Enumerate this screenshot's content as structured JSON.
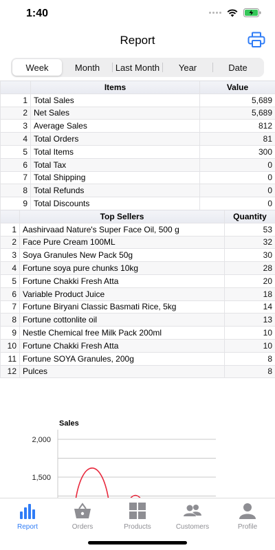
{
  "status": {
    "time": "1:40"
  },
  "nav": {
    "title": "Report"
  },
  "segments": [
    {
      "label": "Week",
      "active": true
    },
    {
      "label": "Month",
      "active": false
    },
    {
      "label": "Last Month",
      "active": false
    },
    {
      "label": "Year",
      "active": false
    },
    {
      "label": "Date",
      "active": false
    }
  ],
  "items_table": {
    "headers": [
      "Items",
      "Value"
    ],
    "rows": [
      {
        "idx": "1",
        "name": "Total Sales",
        "value": "5,689"
      },
      {
        "idx": "2",
        "name": "Net Sales",
        "value": "5,689"
      },
      {
        "idx": "3",
        "name": "Average Sales",
        "value": "812"
      },
      {
        "idx": "4",
        "name": "Total Orders",
        "value": "81"
      },
      {
        "idx": "5",
        "name": "Total Items",
        "value": "300"
      },
      {
        "idx": "6",
        "name": "Total Tax",
        "value": "0"
      },
      {
        "idx": "7",
        "name": "Total Shipping",
        "value": "0"
      },
      {
        "idx": "8",
        "name": "Total Refunds",
        "value": "0"
      },
      {
        "idx": "9",
        "name": "Total Discounts",
        "value": "0"
      }
    ]
  },
  "top_sellers": {
    "headers": [
      "Top Sellers",
      "Quantity"
    ],
    "rows": [
      {
        "idx": "1",
        "name": "Aashirvaad Nature's Super Face Oil, 500 g",
        "qty": "53"
      },
      {
        "idx": "2",
        "name": "Face Pure Cream 100ML",
        "qty": "32"
      },
      {
        "idx": "3",
        "name": "Soya Granules New Pack 50g",
        "qty": "30"
      },
      {
        "idx": "4",
        "name": "Fortune soya pure chunks 10kg",
        "qty": "28"
      },
      {
        "idx": "5",
        "name": "Fortune Chakki Fresh Atta",
        "qty": "20"
      },
      {
        "idx": "6",
        "name": "Variable Product Juice",
        "qty": "18"
      },
      {
        "idx": "7",
        "name": "Fortune Biryani Classic Basmati Rice, 5kg",
        "qty": "14"
      },
      {
        "idx": "8",
        "name": "Fortune cottonlite oil",
        "qty": "13"
      },
      {
        "idx": "9",
        "name": "Nestle Chemical free Milk Pack 200ml",
        "qty": "10"
      },
      {
        "idx": "10",
        "name": "Fortune Chakki Fresh Atta",
        "qty": "10"
      },
      {
        "idx": "11",
        "name": "Fortune SOYA Granules, 200g",
        "qty": "8"
      },
      {
        "idx": "12",
        "name": "Pulces",
        "qty": "8"
      }
    ]
  },
  "chart_data": {
    "type": "line",
    "title": "Sales",
    "y_ticks": [
      "2,000",
      "1,500"
    ],
    "ylim": [
      1300,
      2200
    ],
    "series": [
      {
        "color": "#e8283c",
        "values": [
          1200,
          1700,
          1200
        ]
      }
    ]
  },
  "tabs": [
    {
      "label": "Report",
      "icon": "bar-chart-icon",
      "active": true
    },
    {
      "label": "Orders",
      "icon": "basket-icon",
      "active": false
    },
    {
      "label": "Products",
      "icon": "grid-icon",
      "active": false
    },
    {
      "label": "Customers",
      "icon": "people-icon",
      "active": false
    },
    {
      "label": "Profile",
      "icon": "person-icon",
      "active": false
    }
  ],
  "colors": {
    "accent": "#2f7cf6",
    "inactive": "#8e8e93",
    "line": "#e8283c"
  }
}
